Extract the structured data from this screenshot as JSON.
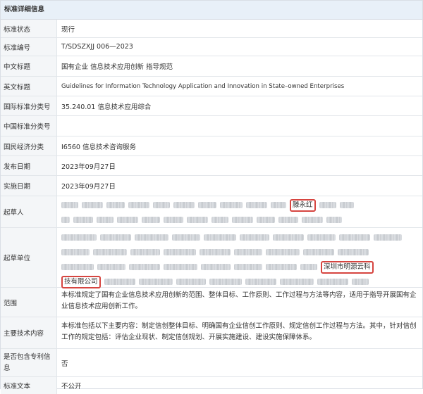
{
  "section_title": "标准详细信息",
  "rows": {
    "status": {
      "label": "标准状态",
      "value": "现行"
    },
    "number": {
      "label": "标准编号",
      "value": "T/SDSZXJJ 006—2023"
    },
    "cn_title": {
      "label": "中文标题",
      "value": "国有企业 信息技术应用创新 指导规范"
    },
    "en_title": {
      "label": "英文标题",
      "value": "Guidelines for Information Technology Application and Innovation in State–owned Enterprises"
    },
    "ics": {
      "label": "国际标准分类号",
      "value": "35.240.01 信息技术应用综合"
    },
    "ccs": {
      "label": "中国标准分类号",
      "value": ""
    },
    "econ": {
      "label": "国民经济分类",
      "value": "I6560 信息技术咨询服务"
    },
    "publish_date": {
      "label": "发布日期",
      "value": "2023年09月27日"
    },
    "impl_date": {
      "label": "实施日期",
      "value": "2023年09月27日"
    },
    "drafters": {
      "label": "起草人",
      "highlight": "滕永红"
    },
    "drafting_units": {
      "label": "起草单位",
      "highlight_1": "深圳市明源云科",
      "highlight_2": "技有限公司"
    },
    "scope": {
      "label": "范围",
      "value": "本标准规定了国有企业信息技术应用创新的范围、整体目标、工作原则、工作过程与方法等内容，适用于指导开展国有企业信息技术应用创新工作。"
    },
    "tech_content": {
      "label": "主要技术内容",
      "value": "本标准包括以下主要内容：制定信创整体目标、明确国有企业信创工作原则、规定信创工作过程与方法。其中，针对信创工作的规定包括：评估企业现状、制定信创规划、开展实施建设、建设实施保障体系。"
    },
    "patent": {
      "label": "是否包含专利信息",
      "value": "否"
    },
    "text": {
      "label": "标准文本",
      "value": "不公开"
    }
  }
}
